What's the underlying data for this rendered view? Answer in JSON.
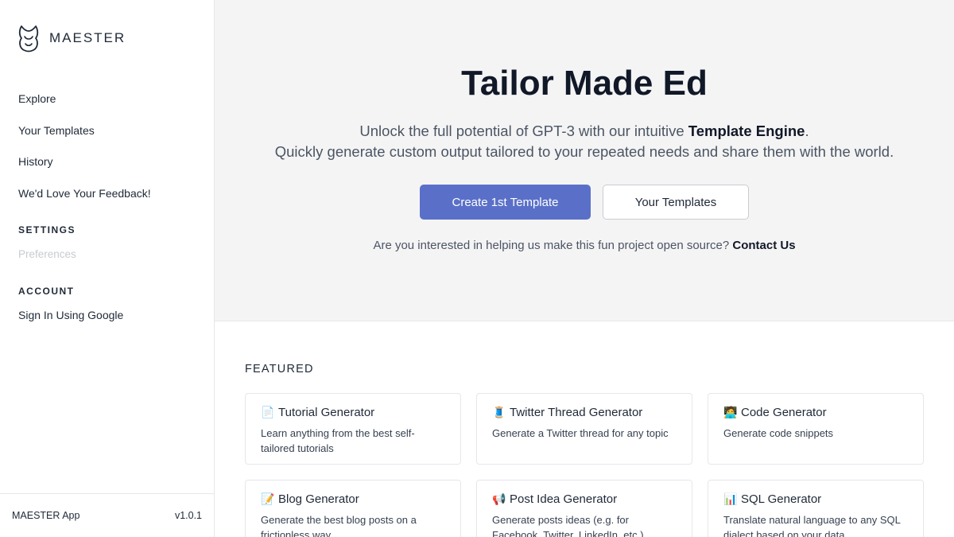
{
  "brand": {
    "name": "MAESTER"
  },
  "sidebar": {
    "nav": [
      {
        "label": "Explore"
      },
      {
        "label": "Your Templates"
      },
      {
        "label": "History"
      },
      {
        "label": "We'd Love Your Feedback!"
      }
    ],
    "settings_title": "SETTINGS",
    "preferences_label": "Preferences",
    "account_title": "ACCOUNT",
    "signin_label": "Sign In Using Google",
    "footer": {
      "app_name": "MAESTER App",
      "version": "v1.0.1"
    }
  },
  "hero": {
    "title": "Tailor Made Ed",
    "subtitle_line1_prefix": "Unlock the full potential of GPT-3 with our intuitive ",
    "subtitle_line1_bold": "Template Engine",
    "subtitle_line1_suffix": ".",
    "subtitle_line2": "Quickly generate custom output tailored to your repeated needs and share them with the world.",
    "primary_button": "Create 1st Template",
    "secondary_button": "Your Templates",
    "cta_text": "Are you interested in helping us make this fun project open source? ",
    "cta_link": "Contact Us"
  },
  "featured": {
    "title": "FEATURED",
    "cards": [
      {
        "icon": "page-icon",
        "emoji": "📄",
        "title": "Tutorial Generator",
        "desc": "Learn anything from the best self-tailored tutorials"
      },
      {
        "icon": "thread-icon",
        "emoji": "🧵",
        "title": "Twitter Thread Generator",
        "desc": "Generate a Twitter thread for any topic"
      },
      {
        "icon": "technologist-icon",
        "emoji": "🧑‍💻",
        "title": "Code Generator",
        "desc": "Generate code snippets"
      },
      {
        "icon": "memo-icon",
        "emoji": "📝",
        "title": "Blog Generator",
        "desc": "Generate the best blog posts on a frictionless way"
      },
      {
        "icon": "megaphone-icon",
        "emoji": "📢",
        "title": "Post Idea Generator",
        "desc": "Generate posts ideas (e.g. for Facebook, Twitter, LinkedIn, etc.)"
      },
      {
        "icon": "bar-chart-icon",
        "emoji": "📊",
        "title": "SQL Generator",
        "desc": "Translate natural language to any SQL dialect based on your data"
      }
    ]
  },
  "colors": {
    "primary": "#5a70c8",
    "hero_bg": "#f4f4f5",
    "border": "#e5e7eb",
    "muted": "#c8cbd1"
  }
}
